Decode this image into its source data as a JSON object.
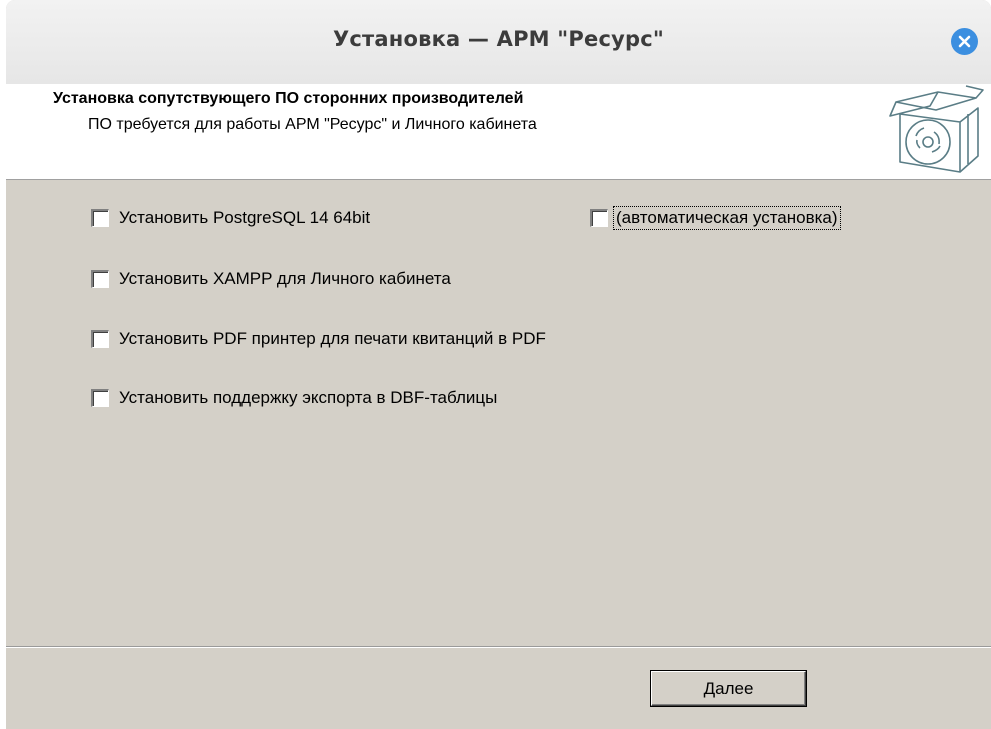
{
  "window": {
    "title": "Установка — АРМ \"Ресурс\""
  },
  "header": {
    "title": "Установка сопутствующего ПО сторонних производителей",
    "subtitle": "ПО требуется для работы АРМ \"Ресурс\" и Личного кабинета",
    "icon": "software-box-cd-icon"
  },
  "options": {
    "postgresql": {
      "label": "Установить PostgreSQL 14 64bit",
      "checked": false
    },
    "auto_install": {
      "label": "(автоматическая установка)",
      "checked": false
    },
    "xampp": {
      "label": "Установить XAMPP для Личного кабинета",
      "checked": false
    },
    "pdf_printer": {
      "label": "Установить PDF принтер для печати квитанций в PDF",
      "checked": false
    },
    "dbf_export": {
      "label": "Установить поддержку экспорта в DBF-таблицы",
      "checked": false
    }
  },
  "footer": {
    "next_first": "Д",
    "next_rest": "алее"
  },
  "colors": {
    "dialog_bg": "#d4d0c8",
    "close_button": "#3c8fe0",
    "header_bg": "#ffffff"
  }
}
